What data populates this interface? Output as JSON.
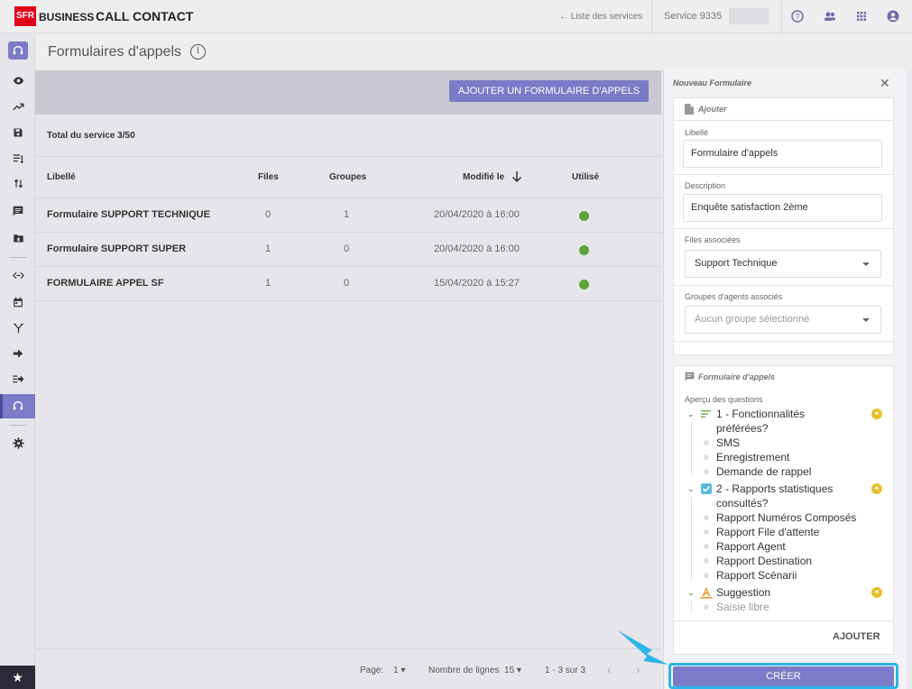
{
  "topbar": {
    "logo": "SFR",
    "brand": "BUSINESS",
    "app_title": "CALL CONTACT",
    "services_link": "← Liste des services",
    "service_label": "Service 9335",
    "icons": [
      "help-icon",
      "users-icon",
      "apps-grid-icon",
      "account-icon"
    ]
  },
  "sidebar": {
    "icons": [
      "headset-icon",
      "eye-icon",
      "trend-icon",
      "save-icon",
      "queue-icon",
      "transfer-icon",
      "message-icon",
      "folder-icon",
      "code-icon",
      "calendar-icon",
      "fork-icon",
      "arrow-icon",
      "forward-icon",
      "headset-active-icon",
      "settings-icon",
      "star-icon"
    ]
  },
  "page": {
    "title": "Formulaires d'appels",
    "add_button": "AJOUTER UN FORMULAIRE D'APPELS",
    "total": "Total du service 3/50"
  },
  "table": {
    "columns": {
      "name": "Libellé",
      "files": "Files",
      "groups": "Groupes",
      "modified": "Modifié le",
      "used": "Utilisé"
    },
    "rows": [
      {
        "name": "Formulaire SUPPORT TECHNIQUE",
        "files": "0",
        "groups": "1",
        "modified": "20/04/2020 à 16:00"
      },
      {
        "name": "Formulaire SUPPORT SUPER",
        "files": "1",
        "groups": "0",
        "modified": "20/04/2020 à 16:00"
      },
      {
        "name": "FORMULAIRE APPEL SF",
        "files": "1",
        "groups": "0",
        "modified": "15/04/2020 à 15:27"
      }
    ],
    "used_color": "#5ea33c"
  },
  "footer": {
    "page_label": "Page:",
    "page_value": "1",
    "rows_label": "Nombre de lignes",
    "rows_value": "15",
    "range": "1 - 3 sur 3"
  },
  "panel": {
    "title": "Nouveau Formulaire",
    "ajouter_section": "Ajouter",
    "libelle_label": "Libellé",
    "libelle_value": "Formulaire d'appels",
    "description_label": "Description",
    "description_value": "Enquête satisfaction 2ème",
    "files_label": "Files associées",
    "files_value": "Support Technique",
    "groups_label": "Groupes d'agents associés",
    "groups_placeholder": "Aucun groupe sélectionné",
    "form_section": "Formulaire d'appels",
    "preview_label": "Aperçu des questions",
    "questions": [
      {
        "line1": "1 - Fonctionnalités",
        "line2": "préférées?",
        "icon": "list-icon",
        "options": [
          "SMS",
          "Enregistrement",
          "Demande de rappel"
        ]
      },
      {
        "line1": "2 - Rapports statistiques",
        "line2": "consultés?",
        "icon": "checkbox-icon",
        "options": [
          "Rapport Numéros Composés",
          "Rapport File d'attente",
          "Rapport Agent",
          "Rapport Destination",
          "Rapport Scénarii"
        ]
      },
      {
        "line1": "Suggestion",
        "line2": "",
        "icon": "text-icon",
        "options": [
          "Saisie libre"
        ]
      }
    ],
    "ajouter_button": "AJOUTER",
    "creer_button": "CRÉER",
    "accent": "#7b7bc7",
    "highlight": "#2bb5e8"
  }
}
